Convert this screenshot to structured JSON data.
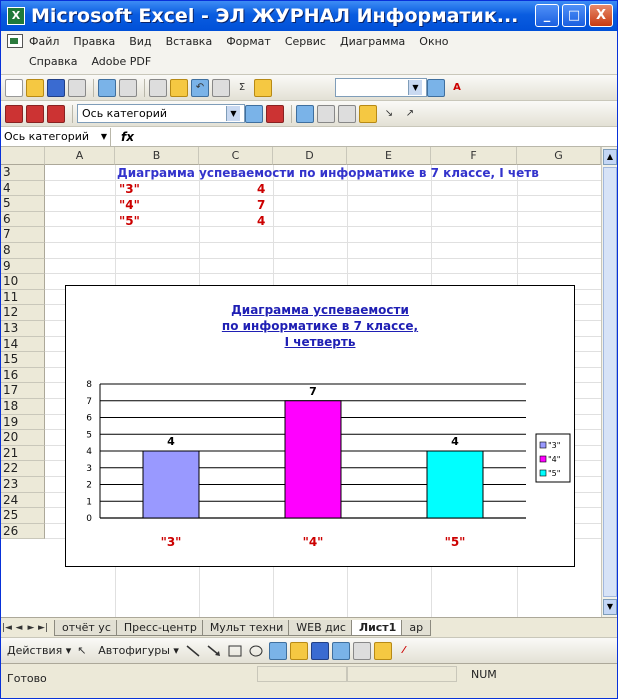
{
  "window": {
    "title": "Microsoft Excel - ЭЛ ЖУРНАЛ Информатик...",
    "min": "_",
    "max": "□",
    "close": "X"
  },
  "menu": {
    "row1": [
      "Файл",
      "Правка",
      "Вид",
      "Вставка",
      "Формат",
      "Сервис",
      "Диаграмма",
      "Окно"
    ],
    "row2": [
      "Справка",
      "Adobe PDF"
    ]
  },
  "toolbar2": {
    "category_combo": "Ось категорий"
  },
  "formula": {
    "name_box": "Ось категорий",
    "fx": "fx"
  },
  "sheet": {
    "columns": [
      "A",
      "B",
      "C",
      "D",
      "E",
      "F",
      "G"
    ],
    "rows": [
      "3",
      "4",
      "5",
      "6",
      "7",
      "8",
      "9",
      "10",
      "11",
      "12",
      "13",
      "14",
      "15",
      "16",
      "17",
      "18",
      "19",
      "20",
      "21",
      "22",
      "23",
      "24",
      "25",
      "26"
    ],
    "heading_text": "Диаграмма успеваемости по информатике в 7 классе, I четв",
    "data": [
      {
        "grade": "\"3\"",
        "count": "4"
      },
      {
        "grade": "\"4\"",
        "count": "7"
      },
      {
        "grade": "\"5\"",
        "count": "4"
      }
    ]
  },
  "chart_data": {
    "type": "bar",
    "title": [
      "Диаграмма успеваемости",
      "по информатике в 7 классе,",
      "I четверть"
    ],
    "categories": [
      "\"3\"",
      "\"4\"",
      "\"5\""
    ],
    "values": [
      4,
      7,
      4
    ],
    "colors": [
      "#9999ff",
      "#ff00ff",
      "#00ffff"
    ],
    "ylim": [
      0,
      8
    ],
    "yticks": [
      "0",
      "1",
      "2",
      "3",
      "4",
      "5",
      "6",
      "7",
      "8"
    ],
    "legend": [
      "\"3\"",
      "\"4\"",
      "\"5\""
    ],
    "legend_position": "right",
    "grid": true
  },
  "tabs": [
    "отчёт ус",
    "Пресс-центр",
    "Мульт техни",
    "WEB дис",
    "Лист1",
    "ар"
  ],
  "active_tab": "Лист1",
  "drawbar": {
    "actions": "Действия ▾",
    "autoshapes": "Автофигуры ▾"
  },
  "status": {
    "ready": "Готово",
    "num": "NUM"
  }
}
